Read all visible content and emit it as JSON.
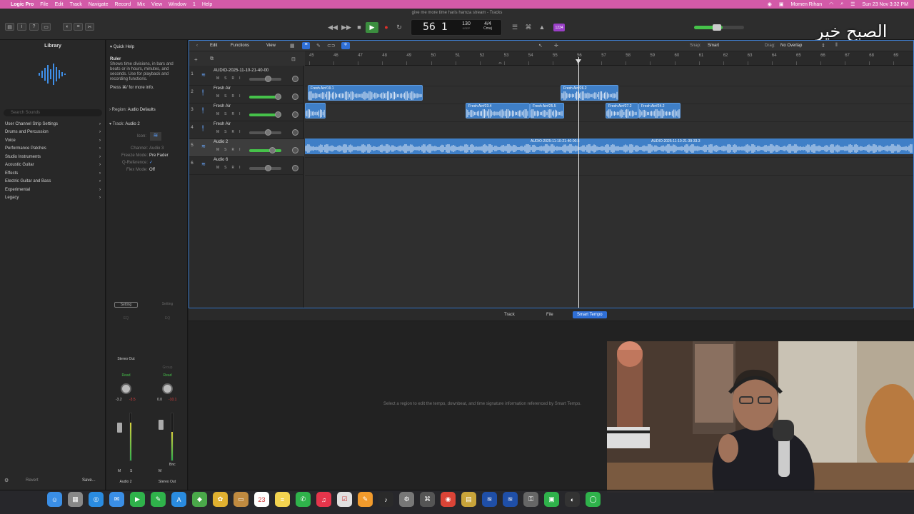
{
  "menubar": {
    "app": "Logic Pro",
    "items": [
      "File",
      "Edit",
      "Track",
      "Navigate",
      "Record",
      "Mix",
      "View",
      "Window",
      "1",
      "Help"
    ],
    "user": "Momen Rihan",
    "datetime": "Sun 23 Nov 3:32 PM"
  },
  "window": {
    "title": "give me more time haris hamza stream - Tracks"
  },
  "transport": {
    "position_bar": "56",
    "position_beat": "1",
    "tempo": "130",
    "tempo_sub": "KEEP",
    "signature": "4/4",
    "key": "Cmaj",
    "cpu_badge": "1234"
  },
  "overlay_text": "الصبح خير",
  "library": {
    "title": "Library",
    "search_placeholder": "Search Sounds",
    "items": [
      "User Channel Strip Settings",
      "Drums and Percussion",
      "Voice",
      "Performance Patches",
      "Studio Instruments",
      "Acoustic Guitar",
      "Effects",
      "Electric Guitar and Bass",
      "Experimental",
      "Legacy"
    ],
    "revert": "Revert",
    "save": "Save..."
  },
  "quick_help": {
    "title": "Quick Help",
    "heading": "Ruler",
    "body": "Shows time divisions, in bars and beats or in hours, minutes, and seconds. Use for playback and recording functions.",
    "shortcut": "Press ⌘/ for more info."
  },
  "inspector": {
    "region_label": "Region:",
    "region_value": "Audio Defaults",
    "track_label": "Track:",
    "track_value": "Audio 2",
    "icon_label": "Icon:",
    "channel_label": "Channel:",
    "channel_value": "Audio 3",
    "freeze_label": "Freeze Mode:",
    "freeze_value": "Pre Fader",
    "qref_label": "Q-Reference:",
    "flex_label": "Flex Mode:",
    "flex_value": "Off"
  },
  "arrange_toolbar": {
    "edit": "Edit",
    "functions": "Functions",
    "view": "View",
    "snap_label": "Snap:",
    "snap_value": "Smart",
    "drag_label": "Drag:",
    "drag_value": "No Overlap"
  },
  "ruler": {
    "bars": [
      "45",
      "46",
      "47",
      "48",
      "49",
      "50",
      "51",
      "52",
      "53",
      "54",
      "55",
      "56",
      "57",
      "58",
      "59",
      "60",
      "61",
      "62",
      "63",
      "64",
      "65",
      "66",
      "67",
      "68",
      "69"
    ]
  },
  "tracks": [
    {
      "num": "1",
      "name": "AUDIO-2025-11-10-21-40-00",
      "m": "M",
      "s": "S",
      "r": "R",
      "i": "I"
    },
    {
      "num": "2",
      "name": "Fresh Air",
      "m": "M",
      "s": "S",
      "r": "R",
      "i": "I"
    },
    {
      "num": "3",
      "name": "Fresh Air",
      "m": "M",
      "s": "S",
      "r": "R",
      "i": "I"
    },
    {
      "num": "4",
      "name": "Fresh Air",
      "m": "M",
      "s": "S",
      "r": "R",
      "i": "I"
    },
    {
      "num": "5",
      "name": "Audio 2",
      "m": "M",
      "s": "S",
      "r": "R",
      "i": "I"
    },
    {
      "num": "6",
      "name": "Audio 6",
      "m": "M",
      "s": "S",
      "r": "R",
      "i": "I"
    }
  ],
  "regions": [
    {
      "name": "Fresh Air#19.1"
    },
    {
      "name": "Fresh Air#26.2"
    },
    {
      "name": "Fresh Air#23.4"
    },
    {
      "name": "Fresh Air#25.5"
    },
    {
      "name": "Fresh Air#27.2"
    },
    {
      "name": "Fresh Air#24.2"
    },
    {
      "name": "AUDIO-2025-11-10-21-40-00.5"
    },
    {
      "name": "AUDIO-2025-11-10-21-39-33.3"
    }
  ],
  "editor": {
    "tabs": [
      "Track",
      "File",
      "Smart Tempo"
    ],
    "message": "Select a region to edit the tempo, downbeat, and time signature information referenced by Smart Tempo."
  },
  "mixer": {
    "strip1": {
      "setting": "Setting",
      "eq": "EQ",
      "output": "Stereo Out",
      "automation": "Read",
      "pan_values": [
        "-3.2",
        "-3.5"
      ],
      "name": "Audio 2",
      "m": "M",
      "s": "S"
    },
    "strip2": {
      "setting": "Setting",
      "eq": "EQ",
      "group": "Group",
      "automation": "Read",
      "pan_values": [
        "0.0",
        "-10.1"
      ],
      "name": "Stereo Out",
      "m": "M",
      "bounce": "Bnc"
    }
  },
  "colors": {
    "menubar": "#d35aa8",
    "region": "#3f7fc7",
    "accent": "#2f6fd6",
    "play": "#3b8e3f"
  }
}
